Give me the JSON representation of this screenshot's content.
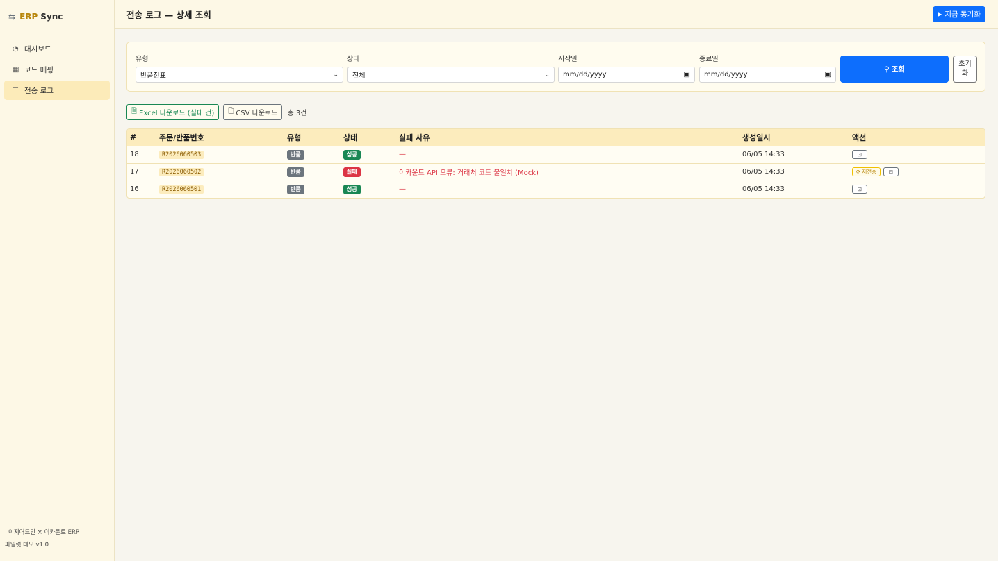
{
  "sidebar": {
    "brand": {
      "icon": "swap-arrows-icon",
      "name": "ERP",
      "suffix": "Sync"
    },
    "items": [
      {
        "label": "대시보드",
        "icon": "speedometer-icon",
        "active": false
      },
      {
        "label": "코드 매핑",
        "icon": "table-icon",
        "active": false
      },
      {
        "label": "전송 로그",
        "icon": "list-icon",
        "active": true
      }
    ],
    "footer": {
      "line1": "이지어드민 × 이카운트 ERP",
      "line2": "파일럿 데모 v1.0"
    }
  },
  "header": {
    "title": "전송 로그 — 상세 조회",
    "sync_button": "지금 동기화"
  },
  "filters": {
    "type": {
      "label": "유형",
      "value": "반품전표"
    },
    "status": {
      "label": "상태",
      "value": "전체"
    },
    "start_date": {
      "label": "시작일",
      "value": "mm/dd/yyyy"
    },
    "end_date": {
      "label": "종료일",
      "value": "mm/dd/yyyy"
    },
    "search_button": "조회",
    "reset_button": "초기화"
  },
  "toolbar": {
    "excel_button": "Excel 다운로드 (실패 건)",
    "csv_button": "CSV 다운로드",
    "total": "총 3건"
  },
  "table": {
    "columns": [
      "#",
      "주문/반품번호",
      "유형",
      "상태",
      "실패 사유",
      "생성일시",
      "액션"
    ],
    "rows": [
      {
        "id": "18",
        "order": "R2026060503",
        "type": "반품",
        "status": "성공",
        "status_color": "#198754",
        "reason": "—",
        "created": "06/05 14:33",
        "retry": ""
      },
      {
        "id": "17",
        "order": "R2026060502",
        "type": "반품",
        "status": "실패",
        "status_color": "#dc3545",
        "reason": "이카운트 API 오류: 거래처 코드 불일치 (Mock)",
        "created": "06/05 14:33",
        "retry": "재전송"
      },
      {
        "id": "16",
        "order": "R2026060501",
        "type": "반품",
        "status": "성공",
        "status_color": "#198754",
        "reason": "—",
        "created": "06/05 14:33",
        "retry": ""
      }
    ]
  },
  "colors": {
    "primary": "#0d6efd",
    "brand": "#b8860b",
    "success": "#198754",
    "danger": "#dc3545",
    "sidebar_bg": "#fdf8e6"
  }
}
